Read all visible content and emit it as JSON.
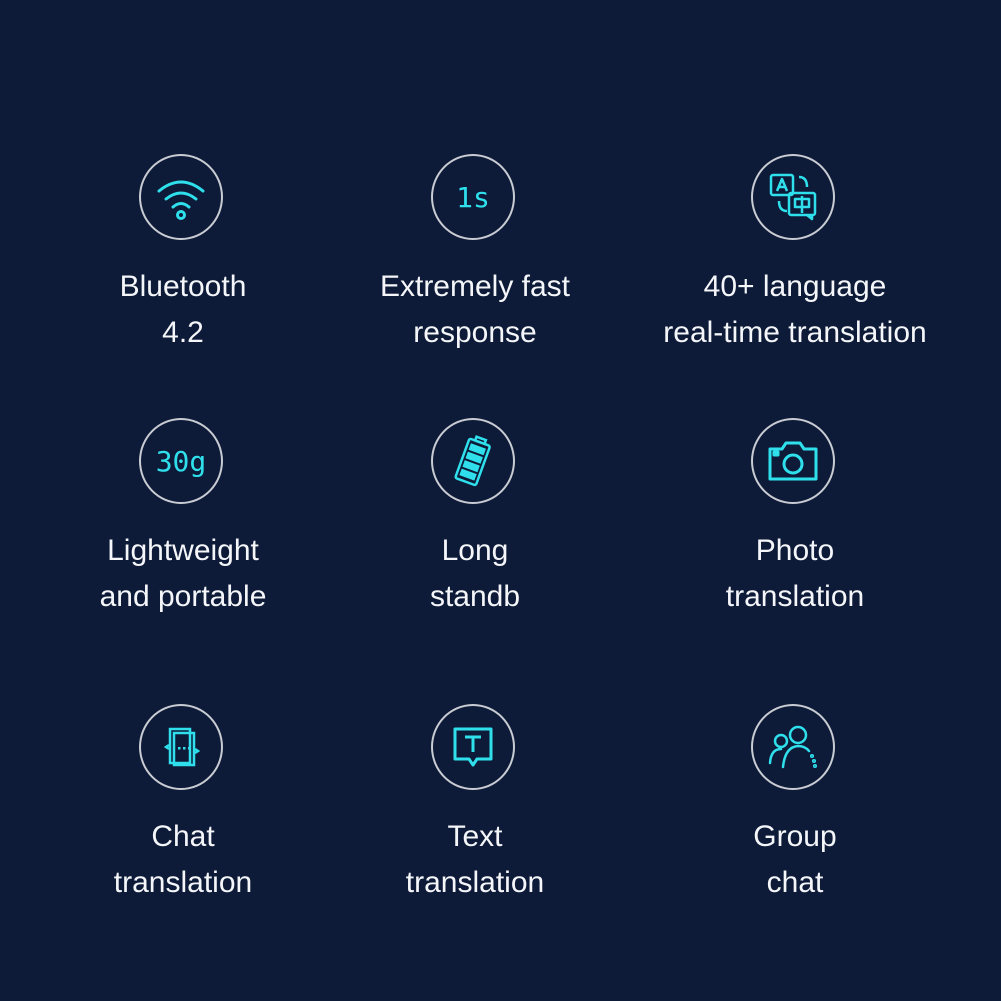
{
  "accent_color": "#2fe0ec",
  "background_color": "#0d1b38",
  "features": [
    {
      "icon": "wifi-icon",
      "line1": "Bluetooth",
      "line2": "4.2"
    },
    {
      "icon": "one-second-icon",
      "icon_text": "1s",
      "line1": "Extremely fast",
      "line2": "response"
    },
    {
      "icon": "translate-icon",
      "line1": "40+ language",
      "line2": "real-time translation"
    },
    {
      "icon": "weight-icon",
      "icon_text": "30g",
      "line1": "Lightweight",
      "line2": "and portable"
    },
    {
      "icon": "battery-icon",
      "line1": "Long",
      "line2": "standb"
    },
    {
      "icon": "camera-icon",
      "line1": "Photo",
      "line2": "translation"
    },
    {
      "icon": "chat-icon",
      "line1": "Chat",
      "line2": "translation"
    },
    {
      "icon": "text-icon",
      "line1": "Text",
      "line2": "translation"
    },
    {
      "icon": "group-icon",
      "line1": "Group",
      "line2": "chat"
    }
  ]
}
